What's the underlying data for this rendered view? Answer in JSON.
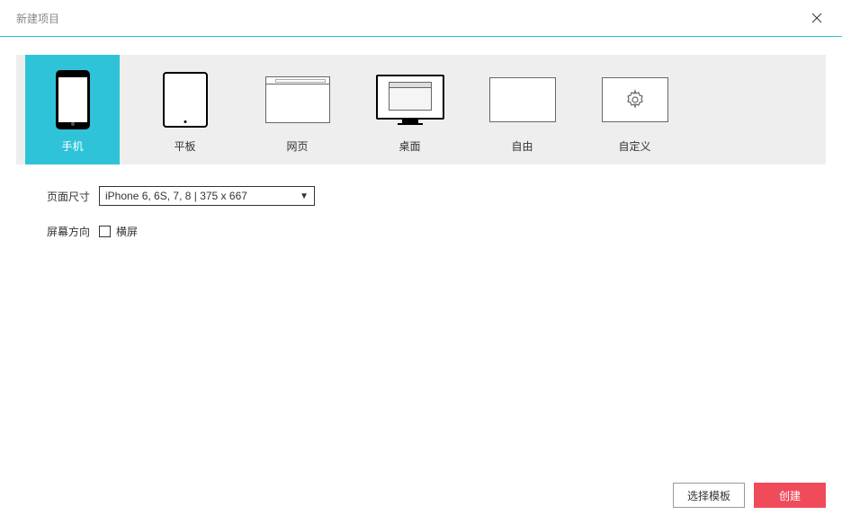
{
  "header": {
    "title": "新建项目"
  },
  "devices": {
    "phone": "手机",
    "tablet": "平板",
    "web": "网页",
    "desktop": "桌面",
    "free": "自由",
    "custom": "自定义"
  },
  "form": {
    "page_size_label": "页面尺寸",
    "page_size_value": "iPhone 6, 6S, 7, 8 | 375 x 667",
    "orientation_label": "屏幕方向",
    "landscape_label": "横屏"
  },
  "footer": {
    "select_template": "选择模板",
    "create": "创建"
  }
}
